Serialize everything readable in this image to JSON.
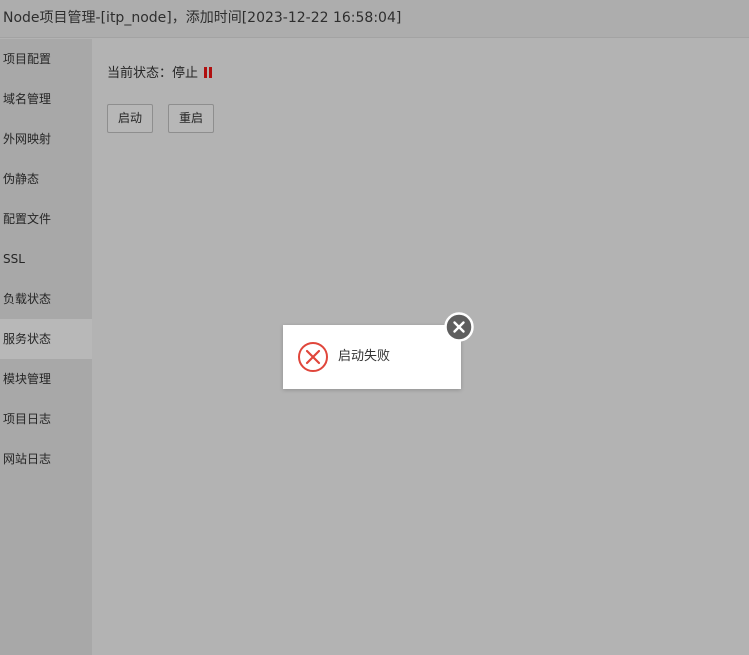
{
  "window": {
    "title": "Node项目管理-[itp_node]，添加时间[2023-12-22 16:58:04]"
  },
  "sidebar": {
    "active_index": 7,
    "items": [
      {
        "label": "项目配置"
      },
      {
        "label": "域名管理"
      },
      {
        "label": "外网映射"
      },
      {
        "label": "伪静态"
      },
      {
        "label": "配置文件"
      },
      {
        "label": "SSL"
      },
      {
        "label": "负载状态"
      },
      {
        "label": "服务状态"
      },
      {
        "label": "模块管理"
      },
      {
        "label": "项目日志"
      },
      {
        "label": "网站日志"
      }
    ]
  },
  "main": {
    "status_label": "当前状态：停止",
    "status_icon": "pause-icon",
    "status_color": "#b01010",
    "start_label": "启动",
    "restart_label": "重启"
  },
  "toast": {
    "icon": "error-x-icon",
    "icon_color": "#e0463b",
    "message": "启动失败",
    "close_icon": "close-icon"
  }
}
